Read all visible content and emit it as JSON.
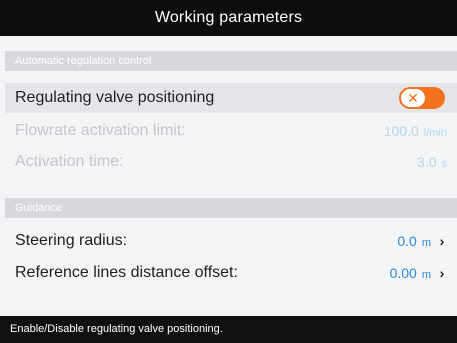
{
  "window": {
    "title": "Working parameters"
  },
  "sections": {
    "auto_regulation": {
      "header": "Automatic regulation control",
      "regulating_valve": {
        "label": "Regulating valve positioning",
        "enabled": false,
        "toggle_glyph": "✕"
      },
      "flowrate_limit": {
        "label": "Flowrate activation limit:",
        "value": "100.0",
        "unit": "l/min"
      },
      "activation_time": {
        "label": "Activation time:",
        "value": "3.0",
        "unit": "s"
      }
    },
    "guidance": {
      "header": "Guidance",
      "steering_radius": {
        "label": "Steering radius:",
        "value": "0.0",
        "unit": "m",
        "icon": "chevron-right-icon"
      },
      "ref_lines_offset": {
        "label": "Reference lines distance offset:",
        "value": "0.00",
        "unit": "m",
        "icon": "chevron-right-icon"
      }
    }
  },
  "status": {
    "text": "Enable/Disable regulating valve positioning."
  },
  "colors": {
    "accent": "#2a8ad3",
    "toggle_off": "#f2711c",
    "title_bg": "#0d0d0d"
  }
}
